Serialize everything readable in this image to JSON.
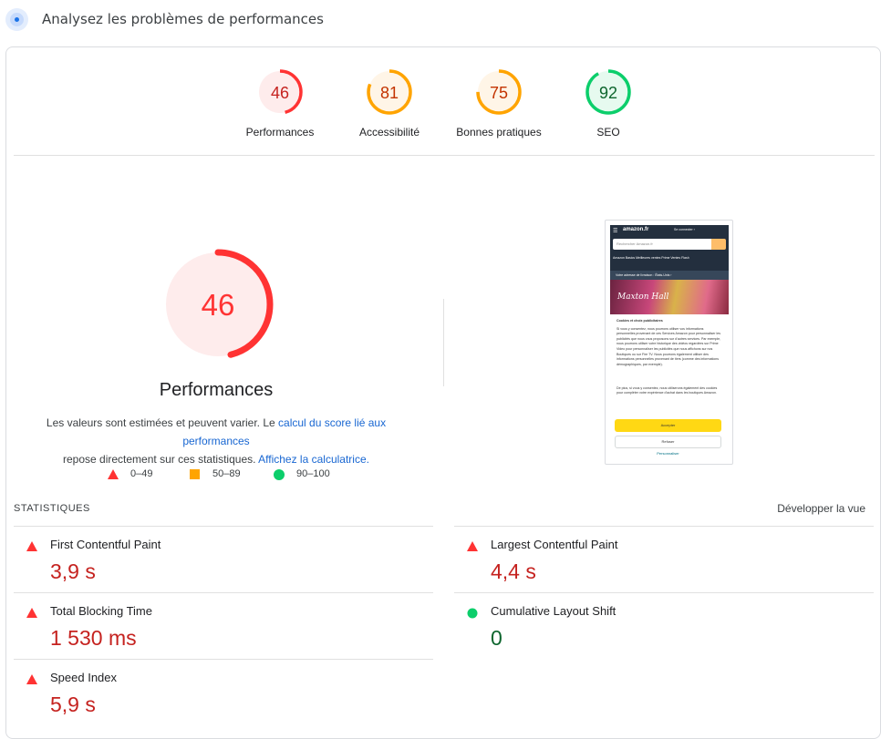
{
  "header": {
    "icon": "lighthouse-radar-icon",
    "title": "Analysez les problèmes de performances"
  },
  "colors": {
    "fail": "#ff3333",
    "fail_text": "#c5221f",
    "average": "#ffa400",
    "average_text": "#c33300",
    "pass": "#0cce6b",
    "pass_text": "#0d652d",
    "link": "#1967d2"
  },
  "category_scores": [
    {
      "label": "Performances",
      "score": 46,
      "rating": "fail"
    },
    {
      "label": "Accessibilité",
      "score": 81,
      "rating": "average"
    },
    {
      "label": "Bonnes pratiques",
      "score": 75,
      "rating": "average"
    },
    {
      "label": "SEO",
      "score": 92,
      "rating": "pass"
    }
  ],
  "main_gauge": {
    "score": "46",
    "label": "Performances"
  },
  "description": {
    "text1": "Les valeurs sont estimées et peuvent varier. Le ",
    "link1": "calcul du score lié aux performances",
    "text2": " repose directement sur ces statistiques. ",
    "link2": "Affichez la calculatrice."
  },
  "legend": [
    {
      "icon": "triangle-icon",
      "range": "0–49"
    },
    {
      "icon": "square-icon",
      "range": "50–89"
    },
    {
      "icon": "circle-icon",
      "range": "90–100"
    }
  ],
  "screenshot": {
    "site_logo": "amazon.fr",
    "account": "Se connecter ›",
    "search_placeholder": "Rechercher Amazon.fr",
    "nav": "Amazon Basics   Meilleures ventes   Prime   Ventes Flash",
    "address": "Votre adresse de livraison : États-Unis ›",
    "banner": "Maxton Hall",
    "modal_title": "Cookies et choix publicitaires",
    "modal_text": "Si vous y consentez, nous pourrons utiliser vos informations personnelles provenant de ces Services Amazon pour personnaliser les publicités que nous vous proposons sur d'autres services. Par exemple, nous pourrons utiliser votre historique des vidéos regardées sur Prime Video pour personnaliser les publicités que nous affichons sur nos Boutiques ou sur Fire TV. Nous pourrons également utiliser des informations personnelles provenant de tiers (comme des informations démographiques, par exemple).",
    "modal_text2": "De plus, si vous y consentez, nous utiliserons également des cookies pour compléter votre expérience d'achat dans les boutiques Amazon.",
    "accept": "Accepter",
    "refuse": "Refuser",
    "personalize": "Personnaliser"
  },
  "stats": {
    "title": "STATISTIQUES",
    "expand": "Développer la vue",
    "metrics": [
      {
        "name": "First Contentful Paint",
        "value": "3,9 s",
        "rating": "fail"
      },
      {
        "name": "Largest Contentful Paint",
        "value": "4,4 s",
        "rating": "fail"
      },
      {
        "name": "Total Blocking Time",
        "value": "1 530 ms",
        "rating": "fail"
      },
      {
        "name": "Cumulative Layout Shift",
        "value": "0",
        "rating": "pass"
      },
      {
        "name": "Speed Index",
        "value": "5,9 s",
        "rating": "fail"
      }
    ]
  }
}
